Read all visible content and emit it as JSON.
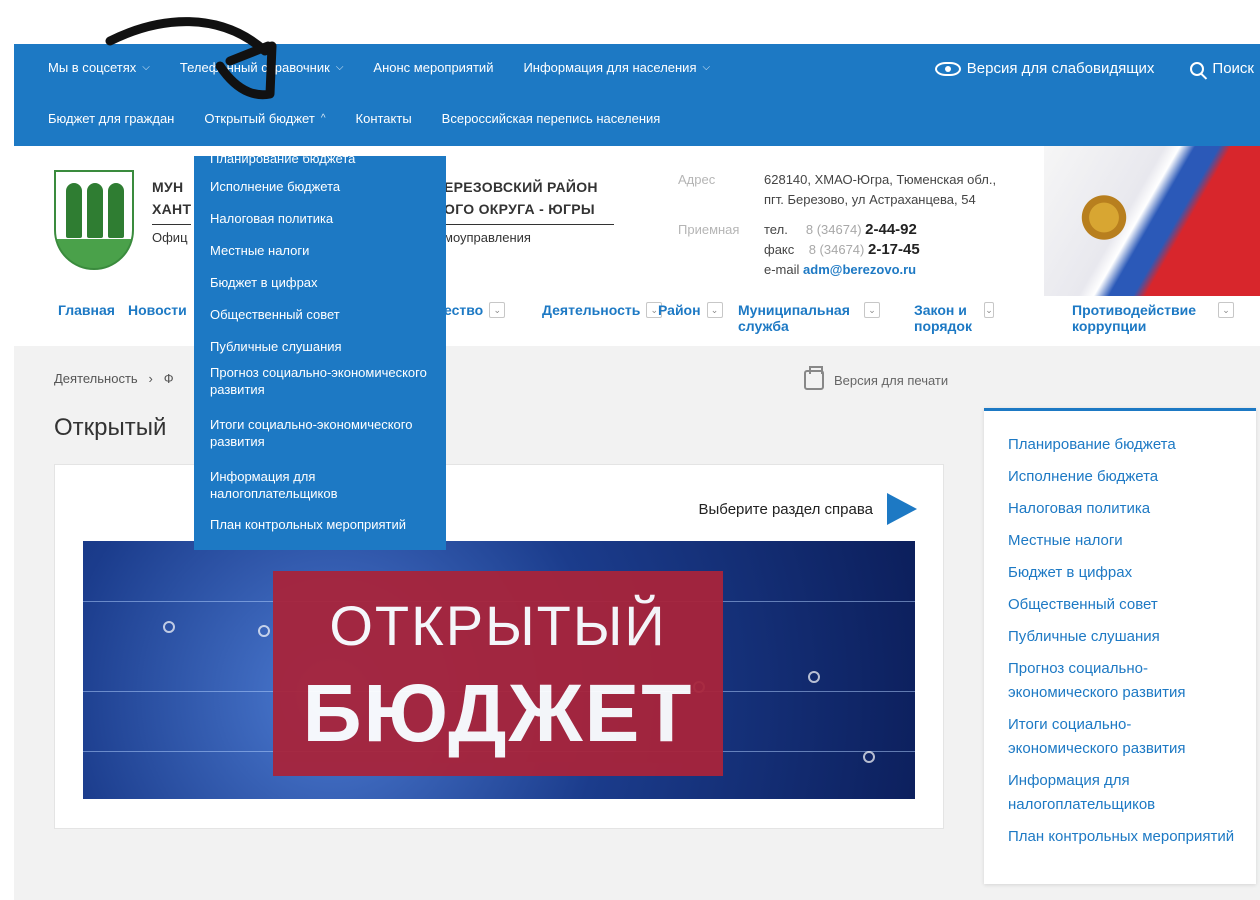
{
  "topbar": {
    "row1": [
      {
        "label": "Мы в соцсетях",
        "has_chevron": true
      },
      {
        "label": "Телефонный справочник",
        "has_chevron": true
      },
      {
        "label": "Анонс мероприятий",
        "has_chevron": false
      },
      {
        "label": "Информация для населения",
        "has_chevron": true
      }
    ],
    "row2": [
      {
        "label": "Бюджет для граждан",
        "has_chevron": false
      },
      {
        "label": "Открытый бюджет",
        "has_chevron": true
      },
      {
        "label": "Контакты",
        "has_chevron": false
      },
      {
        "label": "Всероссийская перепись населения",
        "has_chevron": false
      }
    ],
    "accessibility_label": "Версия для слабовидящих",
    "search_label": "Поиск",
    "icons": {
      "accessibility": "eye-icon",
      "search": "search-icon"
    }
  },
  "dropdown": {
    "items": [
      "Планирование бюджета",
      "Исполнение бюджета",
      "Налоговая политика",
      "Местные налоги",
      "Бюджет в цифрах",
      "Общественный совет",
      "Публичные слушания",
      "Прогноз социально-экономического развития",
      "Итоги социально-экономического развития",
      "Информация для налогоплательщиков",
      "План контрольных мероприятий"
    ]
  },
  "header": {
    "org_left_line1": "МУН",
    "org_left_line2": "ХАНТ",
    "org_left_sub": "Офиц",
    "org_right_line1": "ЕРЕЗОВСКИЙ РАЙОН",
    "org_right_line2": "ОГО ОКРУГА - ЮГРЫ",
    "org_right_sub": "моуправления",
    "address_label": "Адрес",
    "address_line1": "628140, ХМАО-Югра, Тюменская обл.,",
    "address_line2": "пгт. Березово, ул Астраханцева, 54",
    "reception_label": "Приемная",
    "phone_label": "тел.",
    "phone_code": "8 (34674)",
    "phone_number": "2-44-92",
    "fax_label": "факс",
    "fax_code": "8 (34674)",
    "fax_number": "2-17-45",
    "email_label": "e-mail",
    "email": "adm@berezovo.ru"
  },
  "mainnav": {
    "items": [
      {
        "label": "Главная",
        "chevron": false
      },
      {
        "label": "Новости",
        "chevron": false
      },
      {
        "label": "ество",
        "chevron": true
      },
      {
        "label": "Деятельность",
        "chevron": true
      },
      {
        "label": "Район",
        "chevron": true
      },
      {
        "label": "Муниципальная служба",
        "chevron": true
      },
      {
        "label": "Закон и порядок",
        "chevron": true
      },
      {
        "label": "Противодействие коррупции",
        "chevron": true
      }
    ]
  },
  "breadcrumb": {
    "item1": "Деятельность",
    "separator": "›",
    "item2": "Ф"
  },
  "print_label": "Версия для печати",
  "page_title": "Открытый",
  "card": {
    "hint": "Выберите раздел справа",
    "banner_line1": "ОТКРЫТЫЙ",
    "banner_line2": "БЮДЖЕТ"
  },
  "sidebar": {
    "items": [
      "Планирование бюджета",
      "Исполнение бюджета",
      "Налоговая политика",
      "Местные налоги",
      "Бюджет в цифрах",
      "Общественный совет",
      "Публичные слушания",
      "Прогноз социально-экономического развития",
      "Итоги социально-экономического развития",
      "Информация для налогоплательщиков",
      "План контрольных мероприятий"
    ]
  },
  "colors": {
    "brand_blue": "#1d79c4",
    "banner_red": "#a8243b"
  }
}
